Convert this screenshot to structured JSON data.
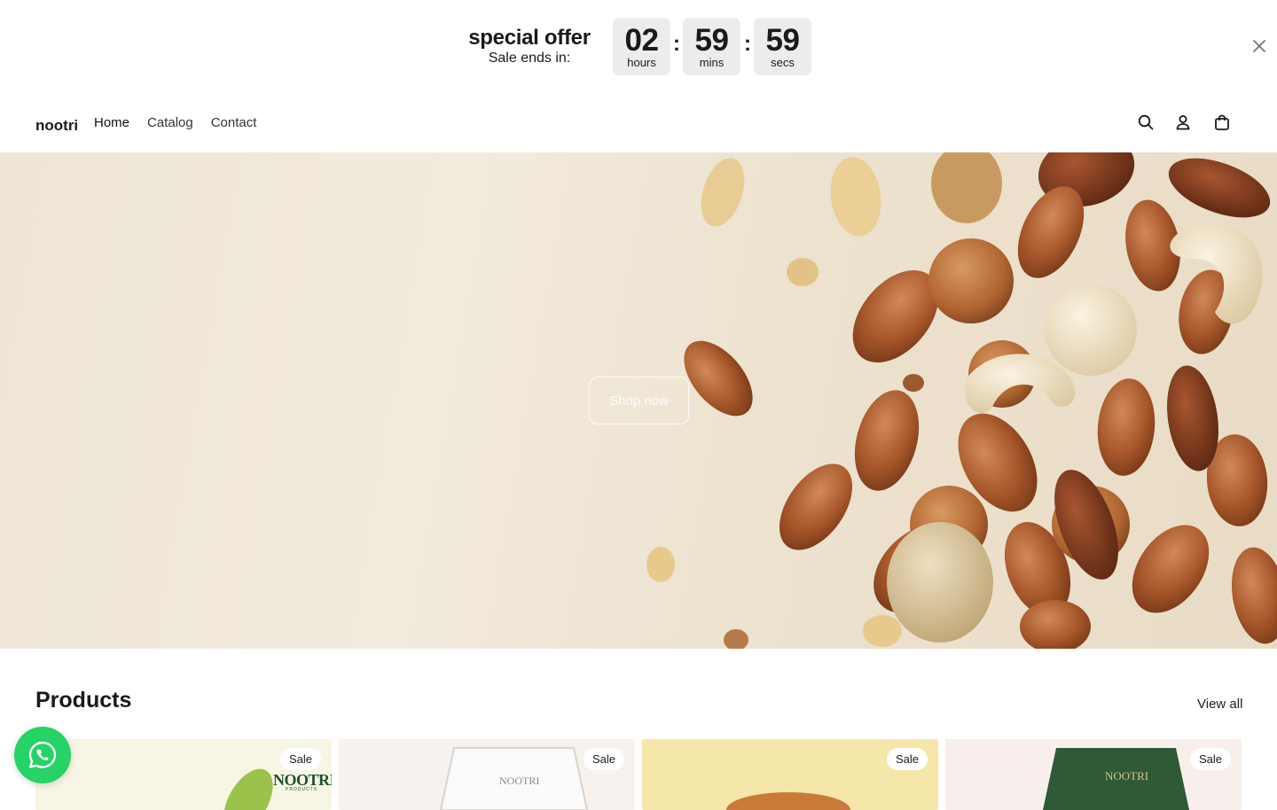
{
  "announcement": {
    "title": "special offer",
    "subtitle": "Sale ends in:",
    "countdown": [
      {
        "value": "02",
        "label": "hours"
      },
      {
        "value": "59",
        "label": "mins"
      },
      {
        "value": "59",
        "label": "secs"
      }
    ],
    "separator": ":"
  },
  "header": {
    "logo": "nootri",
    "nav": [
      "Home",
      "Catalog",
      "Contact"
    ]
  },
  "hero": {
    "cta_label": "Shop now"
  },
  "products": {
    "title": "Products",
    "view_all": "View all",
    "cards": [
      {
        "badge": "Sale",
        "brand": "NOOTRI",
        "brand_sub": "PRODUCTS"
      },
      {
        "badge": "Sale",
        "brand": "NOOTRI"
      },
      {
        "badge": "Sale"
      },
      {
        "badge": "Sale",
        "brand": "NOOTRI"
      }
    ]
  },
  "colors": {
    "whatsapp": "#25d366",
    "countdown_bg": "#ececec"
  }
}
